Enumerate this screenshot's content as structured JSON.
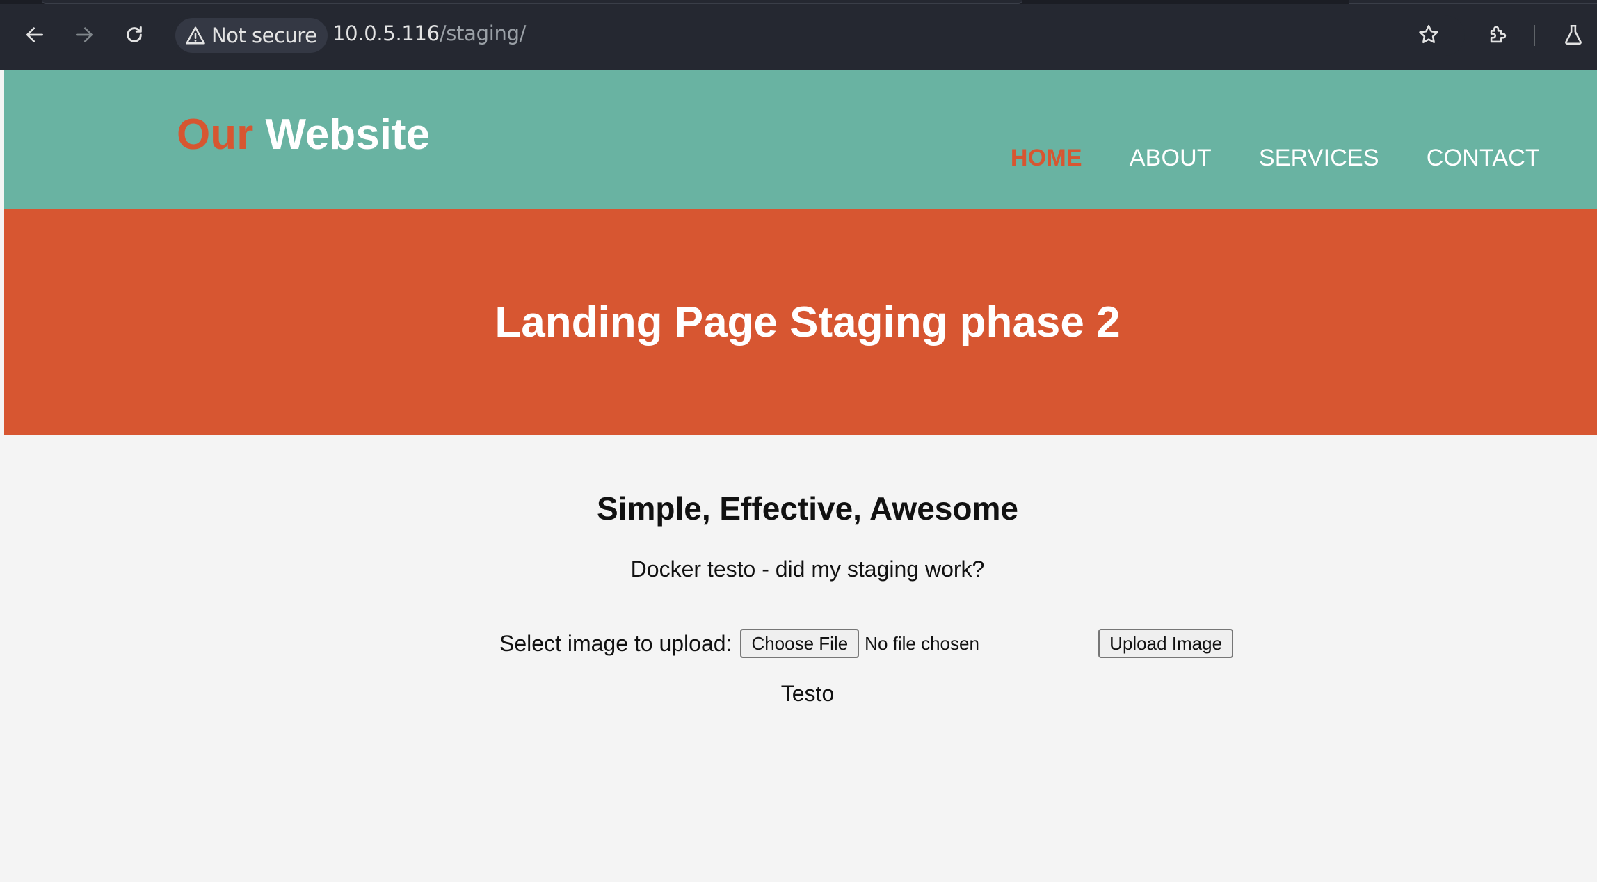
{
  "browser": {
    "security_label": "Not secure",
    "url_host": "10.0.5.116",
    "url_path": "/staging/"
  },
  "site": {
    "logo_accent": "Our",
    "logo_rest": "Website",
    "nav": [
      "HOME",
      "ABOUT",
      "SERVICES",
      "CONTACT"
    ],
    "active_nav": "HOME"
  },
  "hero": {
    "title": "Landing Page Staging phase 2"
  },
  "main": {
    "heading": "Simple, Effective, Awesome",
    "tagline": "Docker testo - did my staging work?",
    "upload_label": "Select image to upload:",
    "choose_file_label": "Choose File",
    "file_status": "No file chosen",
    "upload_button_label": "Upload Image",
    "footer_text": "Testo"
  },
  "colors": {
    "header_bg": "#69b3a2",
    "accent": "#d75631",
    "chrome_bg": "#252831"
  }
}
